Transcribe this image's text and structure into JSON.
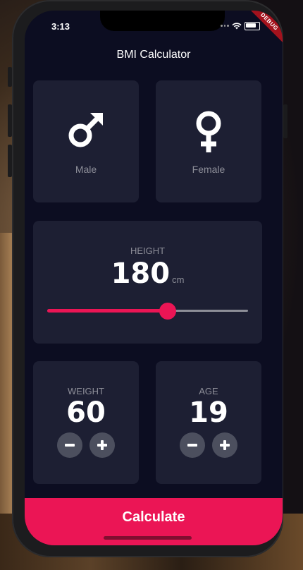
{
  "status_bar": {
    "time": "3:13",
    "debug_label": "DEBUG"
  },
  "app": {
    "title": "BMI Calculator"
  },
  "gender": {
    "male": {
      "label": "Male",
      "icon": "male-symbol-icon"
    },
    "female": {
      "label": "Female",
      "icon": "female-symbol-icon"
    }
  },
  "height": {
    "label": "HEIGHT",
    "value": "180",
    "unit": "cm",
    "slider_fraction": 0.6
  },
  "weight": {
    "label": "WEIGHT",
    "value": "60"
  },
  "age": {
    "label": "AGE",
    "value": "19"
  },
  "calculate": {
    "label": "Calculate"
  },
  "colors": {
    "accent": "#eb1555",
    "card": "#1d1f33",
    "background": "#0c0d21",
    "muted": "#8d8e98",
    "round_button": "#4c4f5e"
  }
}
